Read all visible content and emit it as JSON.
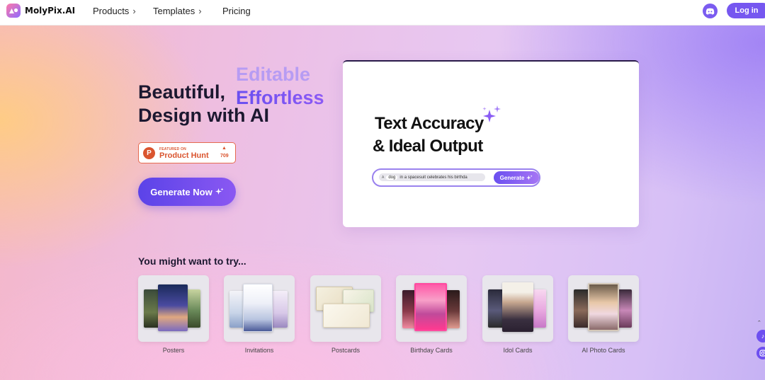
{
  "brand": {
    "name": "MolyPix.AI"
  },
  "nav": {
    "items": [
      {
        "label": "Products",
        "has_chevron": true
      },
      {
        "label": "Templates",
        "has_chevron": true
      },
      {
        "label": "Pricing",
        "has_chevron": false
      }
    ],
    "login_label": "Log in"
  },
  "hero": {
    "word_1": "Editable",
    "word_2": "Effortless",
    "line_1": "Beautiful,",
    "line_2": "Design with AI",
    "product_hunt": {
      "featured": "FEATURED ON",
      "name": "Product Hunt",
      "count": "709"
    },
    "cta_label": "Generate Now"
  },
  "demo": {
    "line_1": "Text Accuracy",
    "line_2": "& Ideal Output",
    "prompt_chip": "dog",
    "prompt_text": "in a spacesuit celebrates his  birthda",
    "prompt_icon": "A",
    "generate_label": "Generate"
  },
  "try": {
    "heading": "You might want to try...",
    "items": [
      {
        "label": "Posters"
      },
      {
        "label": "Invitations"
      },
      {
        "label": "Postcards"
      },
      {
        "label": "Birthday Cards"
      },
      {
        "label": "Idol Cards"
      },
      {
        "label": "AI Photo Cards"
      }
    ]
  },
  "colors": {
    "accent": "#7657f0",
    "product_hunt": "#da552f"
  }
}
